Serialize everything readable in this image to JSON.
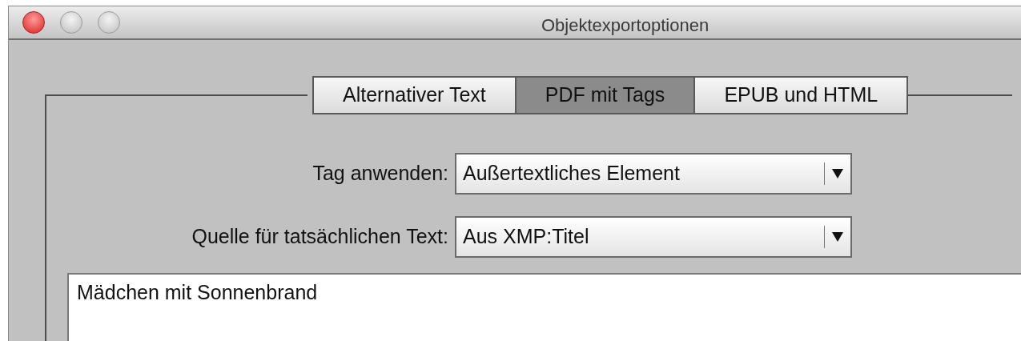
{
  "window": {
    "title": "Objektexportoptionen"
  },
  "tabs": [
    {
      "label": "Alternativer Text",
      "selected": false
    },
    {
      "label": "PDF mit Tags",
      "selected": true
    },
    {
      "label": "EPUB und HTML",
      "selected": false
    }
  ],
  "fields": [
    {
      "label": "Tag anwenden:",
      "value": "Außertextliches Element"
    },
    {
      "label": "Quelle für tatsächlichen Text:",
      "value": "Aus XMP:Titel"
    }
  ],
  "text_area": {
    "value": "Mädchen mit Sonnenbrand"
  }
}
